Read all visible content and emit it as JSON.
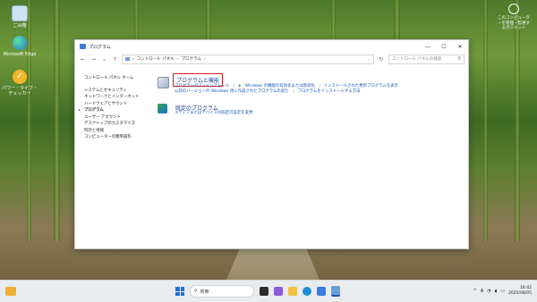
{
  "desktop": {
    "icons": [
      {
        "label": "ごみ箱",
        "icon": "recycle-bin-icon"
      },
      {
        "label": "Microsoft Edge",
        "icon": "edge-icon"
      },
      {
        "label": "パワー・ライフ・チェッカー",
        "icon": "checker-app-icon"
      }
    ],
    "top_right_label": "このコンピューターを管理・監視するガジェット"
  },
  "window": {
    "title": "プログラム",
    "controls": {
      "minimize": "—",
      "maximize": "☐",
      "close": "✕"
    },
    "address": {
      "crumbs": [
        "コントロール パネル",
        "プログラム"
      ],
      "separator": "›"
    },
    "search_placeholder": "コントロール パネルの検索"
  },
  "sidebar": {
    "home": "コントロール パネル ホーム",
    "items": [
      {
        "label": "システムとセキュリティ",
        "current": false
      },
      {
        "label": "ネットワークとインターネット",
        "current": false
      },
      {
        "label": "ハードウェアとサウンド",
        "current": false
      },
      {
        "label": "プログラム",
        "current": true
      },
      {
        "label": "ユーザー アカウント",
        "current": false
      },
      {
        "label": "デスクトップのカスタマイズ",
        "current": false
      },
      {
        "label": "時計と地域",
        "current": false
      },
      {
        "label": "コンピューターの簡単操作",
        "current": false
      }
    ]
  },
  "categories": [
    {
      "title": "プログラムと機能",
      "highlighted": true,
      "links_row1": [
        "プログラムのアンインストール",
        "Windows の機能の有効化または無効化",
        "インストールされた更新プログラムを表示"
      ],
      "links_row2": [
        "以前のバージョンの Windows 用に作成されたプログラムの実行",
        "プログラムをインストールする方法"
      ]
    },
    {
      "title": "既定のプログラム",
      "highlighted": false,
      "links_row1": [
        "メディアまたはデバイスの既定の設定を変更"
      ],
      "links_row2": []
    }
  ],
  "taskbar": {
    "search_label": "検索",
    "clock_time": "16:42",
    "clock_date": "2025/08/05",
    "tray_symbols": [
      "^",
      "A"
    ]
  },
  "colors": {
    "accent": "#1756b3",
    "highlight_border": "#d21f1f",
    "title_link": "#1a3e8c"
  }
}
